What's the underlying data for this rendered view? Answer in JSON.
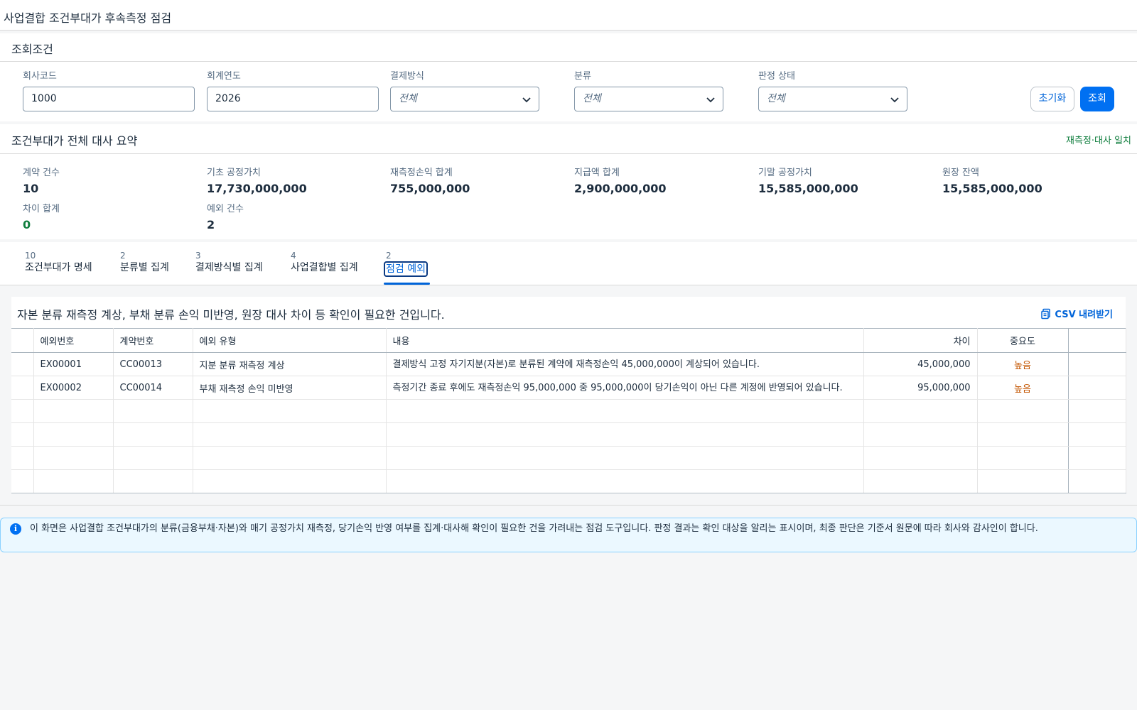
{
  "page": {
    "title": "사업결합 조건부대가 후속측정 점검"
  },
  "filter": {
    "title": "조회조건",
    "fields": [
      {
        "label": "회사코드",
        "value": "1000"
      },
      {
        "label": "회계연도",
        "value": "2026"
      },
      {
        "label": "결제방식",
        "value": "전체"
      },
      {
        "label": "분류",
        "value": "전체"
      },
      {
        "label": "판정 상태",
        "value": "전체"
      }
    ],
    "reset_label": "초기화",
    "search_label": "조회"
  },
  "summary": {
    "title": "조건부대가 전체 대사 요약",
    "status": "재측정·대사 일치",
    "kpis": [
      {
        "label": "계약 건수",
        "value": "10"
      },
      {
        "label": "기초 공정가치",
        "value": "17,730,000,000"
      },
      {
        "label": "재측정손익 합계",
        "value": "755,000,000"
      },
      {
        "label": "지급액 합계",
        "value": "2,900,000,000"
      },
      {
        "label": "기말 공정가치",
        "value": "15,585,000,000"
      },
      {
        "label": "원장 잔액",
        "value": "15,585,000,000"
      },
      {
        "label": "차이 합계",
        "value": "0"
      },
      {
        "label": "예외 건수",
        "value": "2"
      }
    ]
  },
  "tabs": [
    {
      "count": "10",
      "label": "조건부대가 명세"
    },
    {
      "count": "2",
      "label": "분류별 집계"
    },
    {
      "count": "3",
      "label": "결제방식별 집계"
    },
    {
      "count": "4",
      "label": "사업결합별 집계"
    },
    {
      "count": "2",
      "label": "점검 예외"
    }
  ],
  "exceptions": {
    "description": "자본 분류 재측정 계상, 부채 분류 손익 미반영, 원장 대사 차이 등 확인이 필요한 건입니다.",
    "csv_label": "CSV 내려받기",
    "columns": [
      "예외번호",
      "계약번호",
      "예외 유형",
      "내용",
      "차이",
      "중요도"
    ],
    "rows": [
      {
        "id": "EX00001",
        "contract": "CC00013",
        "type": "지분 분류 재측정 계상",
        "content": "결제방식 고정 자기지분(자본)로 분류된 계약에 재측정손익 45,000,000이 계상되어 있습니다.",
        "diff": "45,000,000",
        "severity": "높음"
      },
      {
        "id": "EX00002",
        "contract": "CC00014",
        "type": "부채 재측정 손익 미반영",
        "content": "측정기간 종료 후에도 재측정손익 95,000,000 중 95,000,000이 당기손익이 아닌 다른 계정에 반영되어 있습니다.",
        "diff": "95,000,000",
        "severity": "높음"
      }
    ]
  },
  "info": {
    "text": "이 화면은 사업결합 조건부대가의 분류(금융부채·자본)와 매기 공정가치 재측정, 당기손익 반영 여부를 집계·대사해 확인이 필요한 건을 가려내는 점검 도구입니다. 판정 결과는 확인 대상을 알리는 표시이며, 최종 판단은 기준서 원문에 따라 회사와 감사인이 합니다."
  },
  "colors": {
    "accent": "#0070f2",
    "positive": "#107e3e",
    "critical": "#c35500"
  },
  "icons": [
    "chevron-down-icon",
    "csv-download-icon",
    "info-icon"
  ]
}
